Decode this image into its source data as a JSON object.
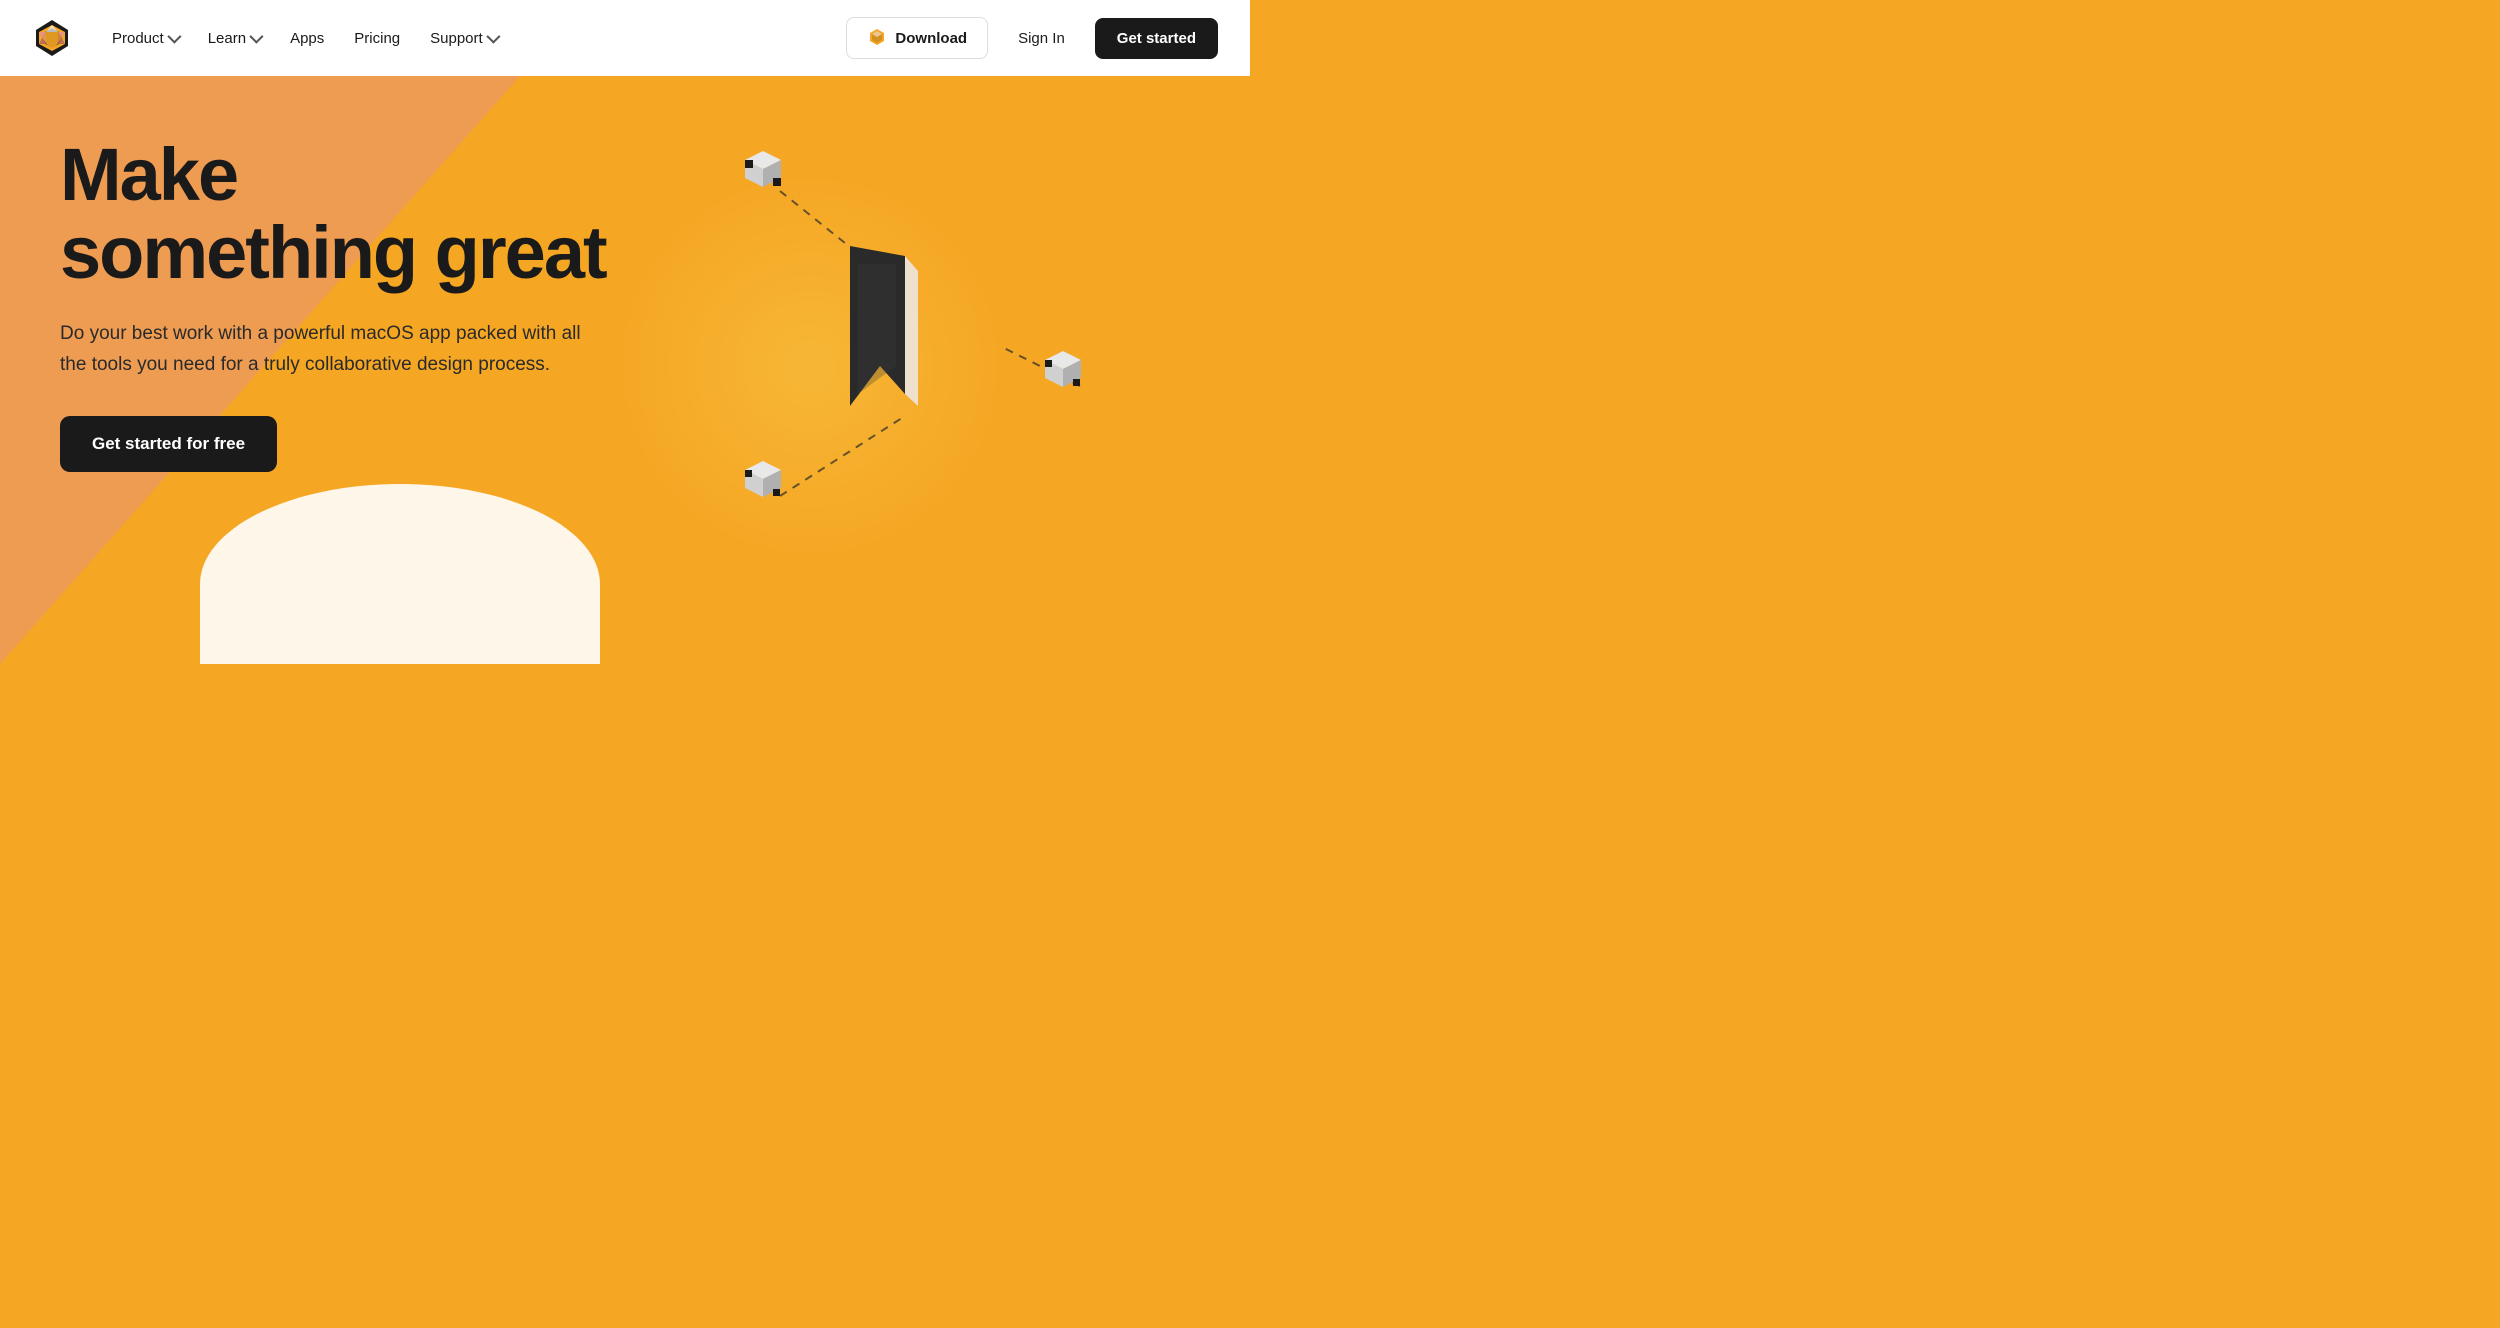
{
  "nav": {
    "logo_alt": "Sketch logo",
    "links": [
      {
        "label": "Product",
        "has_dropdown": true
      },
      {
        "label": "Learn",
        "has_dropdown": true
      },
      {
        "label": "Apps",
        "has_dropdown": false
      },
      {
        "label": "Pricing",
        "has_dropdown": false
      },
      {
        "label": "Support",
        "has_dropdown": true
      }
    ],
    "download_label": "Download",
    "signin_label": "Sign In",
    "getstarted_label": "Get started"
  },
  "hero": {
    "headline_line1": "Make",
    "headline_line2": "something great",
    "subtext": "Do your best work with a powerful macOS app packed with all the tools you need for a truly collaborative design process.",
    "cta_label": "Get started for free"
  },
  "colors": {
    "hero_bg": "#f5a623",
    "nav_bg": "#ffffff",
    "dark": "#1a1a1a",
    "salmon": "#e8937a"
  }
}
